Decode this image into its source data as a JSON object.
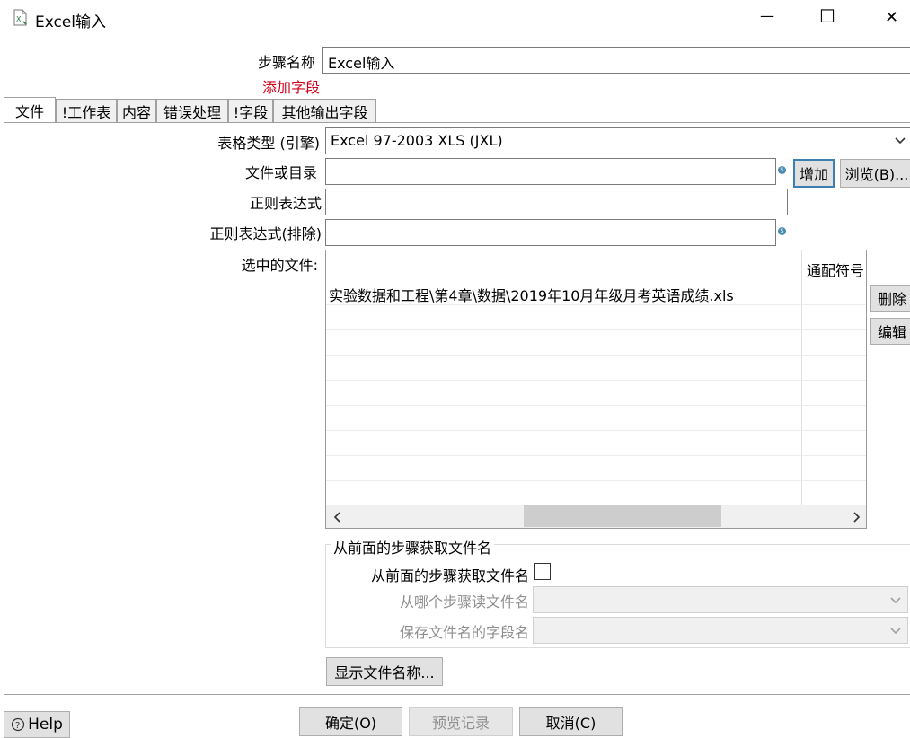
{
  "window": {
    "title": "Excel输入",
    "minimize_glyph": "—",
    "maximize_glyph": "☐",
    "close_glyph": "✕"
  },
  "header": {
    "step_name_label": "步骤名称",
    "step_name_value": "Excel输入",
    "add_field_link": "添加字段"
  },
  "tabs": [
    {
      "label": "文件"
    },
    {
      "label": "!工作表"
    },
    {
      "label": "内容"
    },
    {
      "label": "错误处理"
    },
    {
      "label": "!字段"
    },
    {
      "label": "其他输出字段"
    }
  ],
  "file_tab": {
    "spreadsheet_type_label": "表格类型 (引擎)",
    "spreadsheet_type_value": "Excel 97-2003 XLS (JXL)",
    "file_or_dir_label": "文件或目录",
    "file_or_dir_value": "",
    "add_button": "增加",
    "browse_button": "浏览(B)...",
    "regex_label": "正则表达式",
    "regex_value": "",
    "regex_exclude_label": "正则表达式(排除)",
    "regex_exclude_value": "",
    "selected_files_label": "选中的文件:",
    "selected_files_columns": [
      "",
      "通配符号"
    ],
    "selected_files_rows": [
      {
        "path": "实验数据和工程\\第4章\\数据\\2019年10月年级月考英语成绩.xls",
        "wildcard": ""
      }
    ],
    "delete_button": "删除",
    "edit_button": "编辑",
    "from_prev_group_title": "从前面的步骤获取文件名",
    "from_prev_checkbox_label": "从前面的步骤获取文件名",
    "from_prev_checked": false,
    "read_step_label": "从哪个步骤读文件名",
    "read_step_value": "",
    "field_name_label": "保存文件名的字段名",
    "field_name_value": "",
    "show_filenames_button": "显示文件名称..."
  },
  "footer": {
    "help_button": "Help",
    "ok_button": "确定(O)",
    "preview_button": "预览记录",
    "cancel_button": "取消(C)"
  }
}
